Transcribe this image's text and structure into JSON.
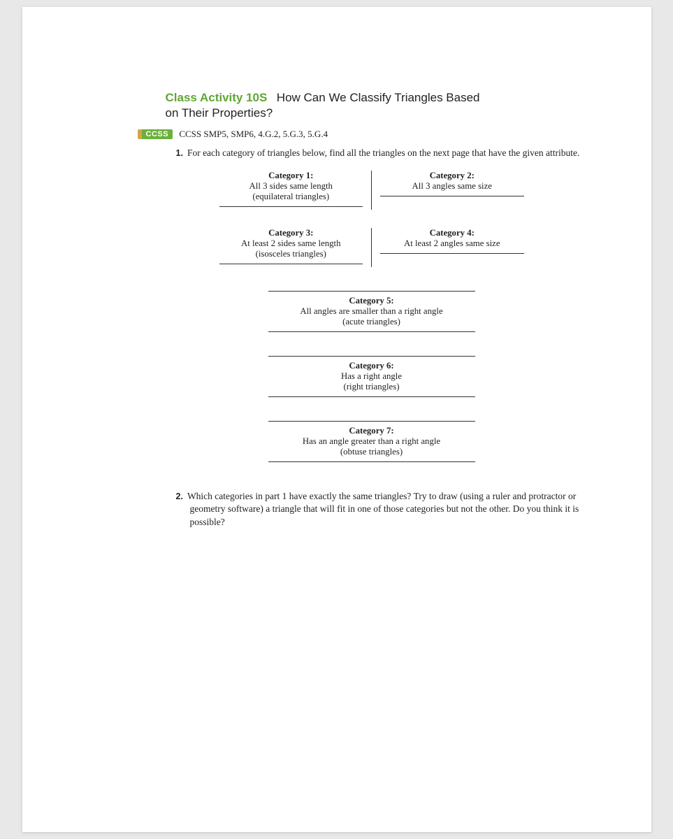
{
  "header": {
    "activity_label": "Class Activity 10S",
    "title_line1": "How Can We Classify Triangles Based",
    "title_line2": "on Their Properties?"
  },
  "ccss": {
    "badge": "CCSS",
    "text": "CCSS SMP5, SMP6, 4.G.2, 5.G.3, 5.G.4"
  },
  "q1": {
    "num": "1.",
    "text": "For each category of triangles below, find all the triangles on the next page that have the given attribute."
  },
  "categories": {
    "c1": {
      "title": "Category 1:",
      "desc": "All 3 sides same length",
      "paren": "(equilateral triangles)"
    },
    "c2": {
      "title": "Category 2:",
      "desc": "All 3 angles same size",
      "paren": ""
    },
    "c3": {
      "title": "Category 3:",
      "desc": "At least 2 sides same length",
      "paren": "(isosceles triangles)"
    },
    "c4": {
      "title": "Category 4:",
      "desc": "At least 2 angles same size",
      "paren": ""
    },
    "c5": {
      "title": "Category 5:",
      "desc": "All angles are smaller than a right angle",
      "paren": "(acute triangles)"
    },
    "c6": {
      "title": "Category 6:",
      "desc": "Has a right angle",
      "paren": "(right triangles)"
    },
    "c7": {
      "title": "Category 7:",
      "desc": "Has an angle greater than a right angle",
      "paren": "(obtuse triangles)"
    }
  },
  "q2": {
    "num": "2.",
    "text": "Which categories in part 1 have exactly the same triangles? Try to draw (using a ruler and protractor or geometry software) a triangle that will fit in one of those categories but not the other. Do you think it is possible?"
  }
}
